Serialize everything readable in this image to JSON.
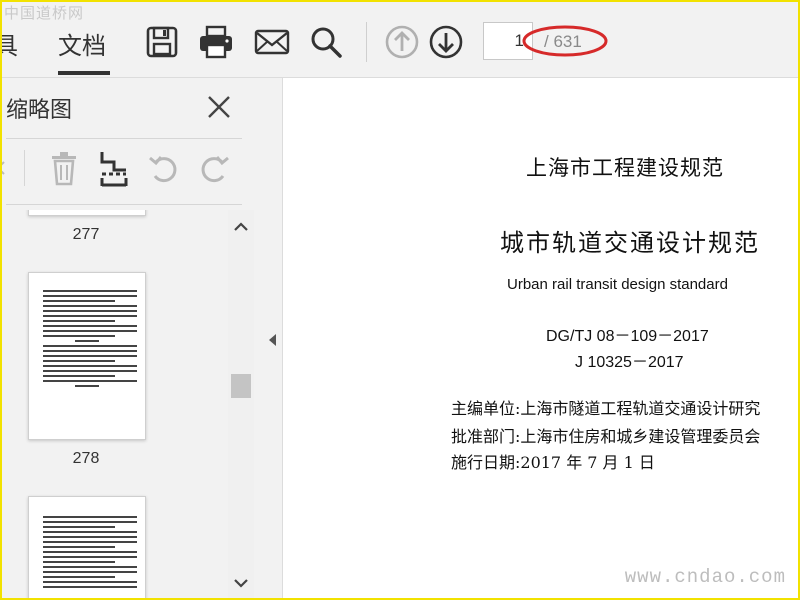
{
  "watermarks": {
    "top": "中国道桥网",
    "bottom": "www.cndao.com"
  },
  "toolbar": {
    "tabs": [
      {
        "label": "具"
      },
      {
        "label": "文档"
      }
    ],
    "icons": [
      "save-icon",
      "print-icon",
      "mail-icon",
      "search-icon",
      "page-up-icon",
      "page-down-icon"
    ],
    "page_input_value": "1",
    "page_total": "/ 631",
    "highlight_color": "#d62a2a"
  },
  "sidebar": {
    "title": "缩略图",
    "tools": [
      "delete-icon",
      "extract-icon",
      "rotate-left-icon",
      "rotate-right-icon"
    ],
    "thumbnails": [
      {
        "page": "277"
      },
      {
        "page": "278"
      }
    ]
  },
  "document": {
    "lines": [
      "上海市工程建设规范",
      "城市轨道交通设计规范",
      "Urban rail transit design standard",
      "DG/TJ 08－109－2017",
      "J 10325－2017",
      "主编单位:上海市隧道工程轨道交通设计研究",
      "批准部门:上海市住房和城乡建设管理委员会",
      "施行日期:2017 年 7 月 1 日"
    ]
  },
  "colors": {
    "frame": "#f2e200",
    "accent_gray": "#8a8a8a"
  }
}
